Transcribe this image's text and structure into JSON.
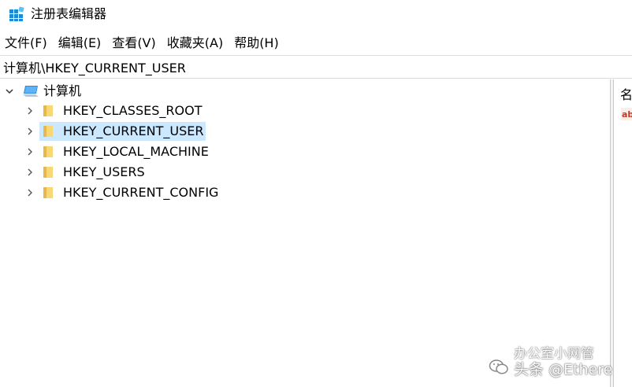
{
  "window": {
    "title": "注册表编辑器"
  },
  "menu": {
    "items": [
      {
        "label": "文件(F)"
      },
      {
        "label": "编辑(E)"
      },
      {
        "label": "查看(V)"
      },
      {
        "label": "收藏夹(A)"
      },
      {
        "label": "帮助(H)"
      }
    ]
  },
  "address": {
    "path": "计算机\\HKEY_CURRENT_USER"
  },
  "tree": {
    "root": {
      "label": "计算机",
      "icon": "computer-icon"
    },
    "children": [
      {
        "label": "HKEY_CLASSES_ROOT",
        "icon": "folder-icon",
        "selected": false
      },
      {
        "label": "HKEY_CURRENT_USER",
        "icon": "folder-icon",
        "selected": true
      },
      {
        "label": "HKEY_LOCAL_MACHINE",
        "icon": "folder-icon",
        "selected": false
      },
      {
        "label": "HKEY_USERS",
        "icon": "folder-icon",
        "selected": false
      },
      {
        "label": "HKEY_CURRENT_CONFIG",
        "icon": "folder-icon",
        "selected": false
      }
    ]
  },
  "values": {
    "column_header": "名",
    "first_value_icon": "string-value-icon"
  },
  "watermark": {
    "line1": "办公室小网管",
    "line2": "头条 @Ethere"
  },
  "colors": {
    "selection": "#cce8ff",
    "folder": "#f8d775",
    "folder_dark": "#e8b84a",
    "accent": "#0078d7"
  }
}
